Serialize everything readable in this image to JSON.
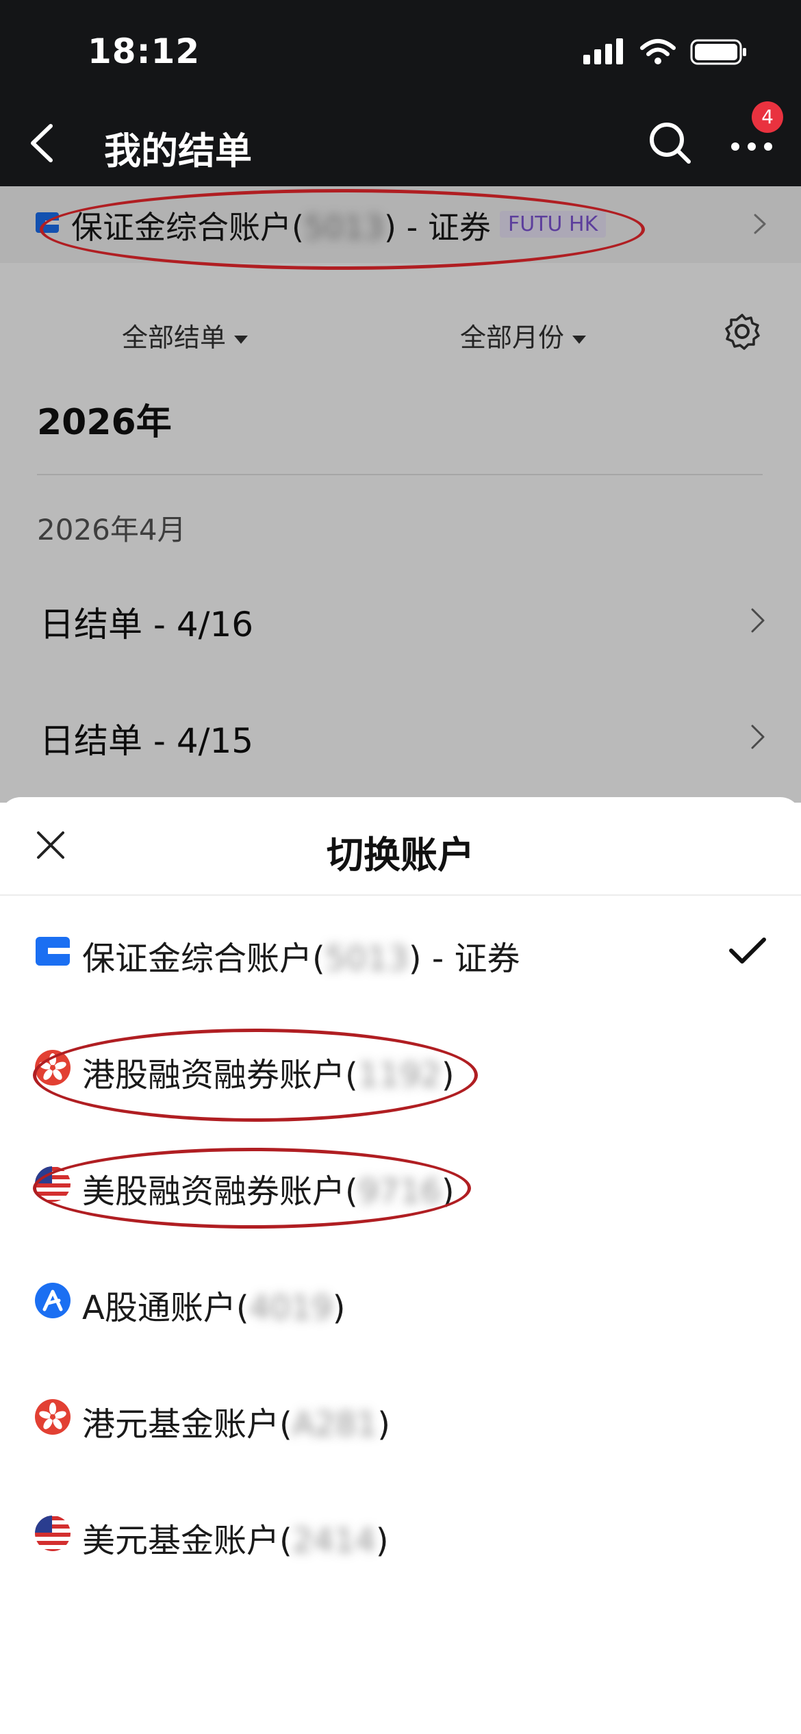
{
  "status_bar": {
    "time": "18:12"
  },
  "header": {
    "title": "我的结单",
    "notification_count": "4"
  },
  "current_account": {
    "name_prefix": "保证金综合账户(",
    "masked_id": "5013",
    "name_suffix": ") - 证券",
    "brand_tag": "FUTU HK"
  },
  "filters": {
    "statement_type": "全部结单",
    "month": "全部月份"
  },
  "year_title": "2026年",
  "month_label": "2026年4月",
  "statements": [
    {
      "label": "日结单 - 4/16"
    },
    {
      "label": "日结单 - 4/15"
    }
  ],
  "sheet": {
    "title": "切换账户",
    "accounts": [
      {
        "name": "保证金综合账户(",
        "masked_id": "5013",
        "suffix": ") - 证券",
        "icon": "card-icon",
        "selected": true
      },
      {
        "name": "港股融资融券账户(",
        "masked_id": "1192",
        "suffix": ")",
        "icon": "hk-flag-icon",
        "selected": false
      },
      {
        "name": "美股融资融券账户(",
        "masked_id": "9716",
        "suffix": ")",
        "icon": "us-flag-icon",
        "selected": false
      },
      {
        "name": "A股通账户(",
        "masked_id": "4019",
        "suffix": ")",
        "icon": "a-share-icon",
        "selected": false
      },
      {
        "name": "港元基金账户(",
        "masked_id": "A281",
        "suffix": ")",
        "icon": "hk-flag-icon",
        "selected": false
      },
      {
        "name": "美元基金账户(",
        "masked_id": "2414",
        "suffix": ")",
        "icon": "us-flag-icon",
        "selected": false
      }
    ]
  },
  "colors": {
    "header_bg": "#141517",
    "badge": "#e9323f",
    "annotation": "#b01e22",
    "brand_tag_text": "#7f55d6",
    "account_blue": "#1b6ff2",
    "hk_red": "#e24033"
  }
}
